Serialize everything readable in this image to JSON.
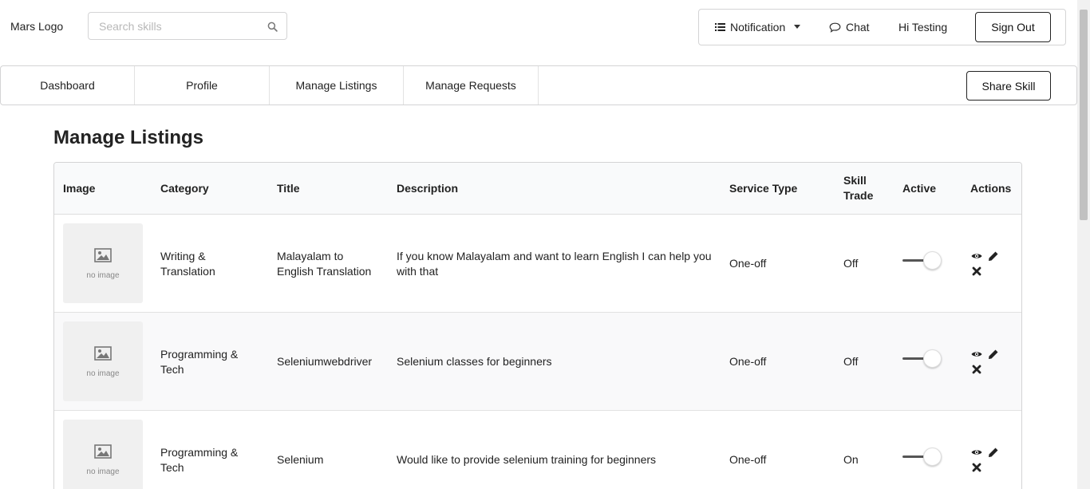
{
  "header": {
    "logo": "Mars Logo",
    "search_placeholder": "Search skills",
    "notification_label": "Notification",
    "chat_label": "Chat",
    "greeting": "Hi Testing",
    "signout_label": "Sign Out"
  },
  "tabs": [
    {
      "label": "Dashboard"
    },
    {
      "label": "Profile"
    },
    {
      "label": "Manage Listings"
    },
    {
      "label": "Manage Requests"
    }
  ],
  "share_label": "Share Skill",
  "page_title": "Manage Listings",
  "table": {
    "headers": {
      "image": "Image",
      "category": "Category",
      "title": "Title",
      "description": "Description",
      "service_type": "Service Type",
      "skill_trade": "Skill Trade",
      "active": "Active",
      "actions": "Actions"
    },
    "rows": [
      {
        "image_text": "no image",
        "category": "Writing & Translation",
        "title": "Malayalam to English Translation",
        "description": "If you know Malayalam and want to learn English I can help you with that",
        "service_type": "One-off",
        "skill_trade": "Off",
        "active": true
      },
      {
        "image_text": "no image",
        "category": "Programming & Tech",
        "title": "Seleniumwebdriver",
        "description": "Selenium classes for beginners",
        "service_type": "One-off",
        "skill_trade": "Off",
        "active": true
      },
      {
        "image_text": "no image",
        "category": "Programming & Tech",
        "title": "Selenium",
        "description": "Would like to provide selenium training for beginners",
        "service_type": "One-off",
        "skill_trade": "On",
        "active": true
      }
    ]
  },
  "icons": {
    "search": "search-icon",
    "notification": "list-icon",
    "dropdown": "caret-down-icon",
    "chat": "chat-bubble-icon",
    "view": "eye-icon",
    "edit": "pencil-icon",
    "delete": "close-icon",
    "image": "image-placeholder-icon"
  }
}
